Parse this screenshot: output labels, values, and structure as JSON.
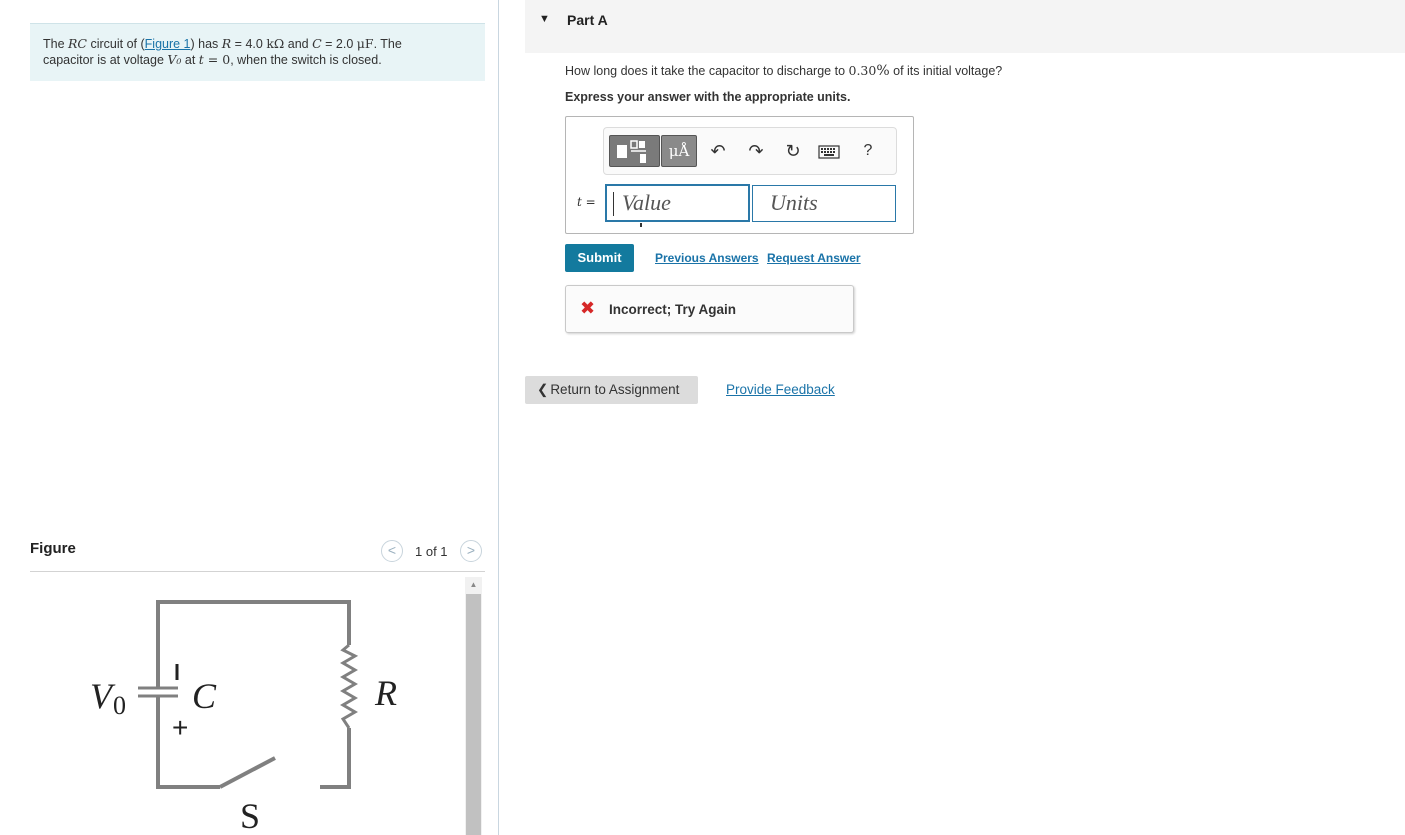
{
  "problem": {
    "text_1": "The ",
    "rc": "RC",
    "text_2": " circuit of (",
    "figure_link": "Figure 1",
    "text_3": ") has ",
    "r_symbol": "R",
    "r_value": " = 4.0 ",
    "r_unit": "kΩ",
    "text_4": " and ",
    "c_symbol": "C",
    "c_value": " = 2.0 ",
    "c_unit": "μF",
    "text_5": ". The",
    "text_6": "capacitor is at voltage ",
    "v0": "V₀",
    "text_7": " at ",
    "t_symbol": "t",
    "t_eq": " = 0",
    "text_8": ", when the switch is closed."
  },
  "figure": {
    "title": "Figure",
    "counter": "1 of 1",
    "prev_glyph": "<",
    "next_glyph": ">",
    "circuit_labels": {
      "v0": "V",
      "v0_sub": "0",
      "capacitor": "C",
      "resistor": "R",
      "switch": "S",
      "plus": "+"
    }
  },
  "part": {
    "title": "Part A",
    "question_prefix": "How long does it take the capacitor to discharge to ",
    "question_value": "0.30",
    "question_percent": "%",
    "question_suffix": " of its initial voltage?",
    "instructions": "Express your answer with the appropriate units."
  },
  "answer": {
    "variable": "t =",
    "value_placeholder": "Value",
    "units_placeholder": "Units",
    "toolbar": {
      "units_label": "μÅ",
      "undo_icon": "undo-icon",
      "redo_icon": "redo-icon",
      "reset_icon": "reset-icon",
      "keyboard_icon": "keyboard-icon",
      "help": "?"
    }
  },
  "actions": {
    "submit": "Submit",
    "previous_answers": "Previous Answers",
    "request_answer": "Request Answer"
  },
  "feedback": {
    "icon": "x-icon",
    "message": "Incorrect; Try Again",
    "color": "#d62828"
  },
  "footer": {
    "return": "Return to Assignment",
    "provide_feedback": "Provide Feedback"
  },
  "colors": {
    "accent": "#137a9e",
    "link": "#1a73a8",
    "problem_bg": "#e8f4f6"
  }
}
